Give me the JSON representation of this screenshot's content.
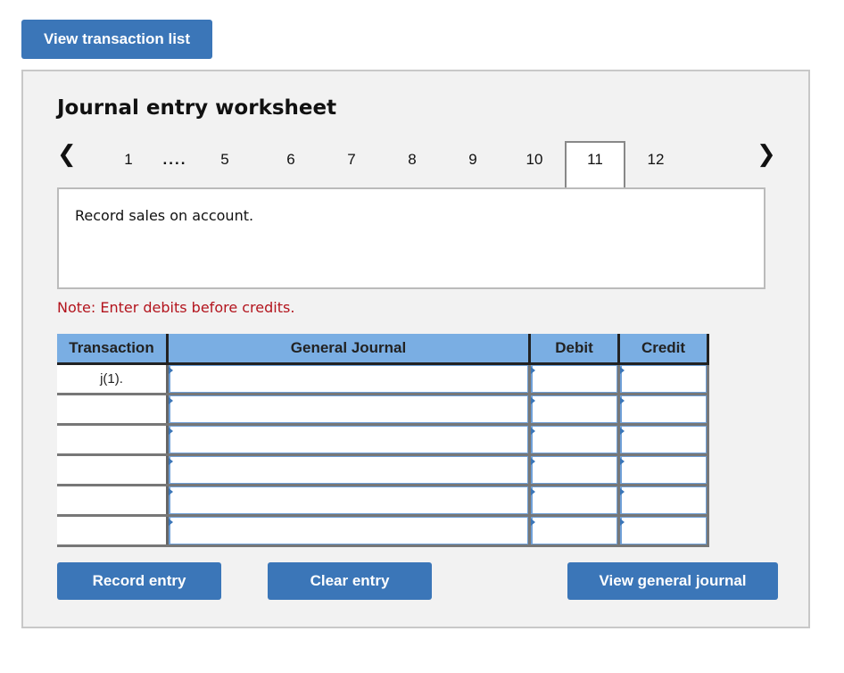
{
  "header": {
    "view_list_label": "View transaction list"
  },
  "worksheet": {
    "title": "Journal entry worksheet",
    "prev_icon": "chevron-left-icon",
    "next_icon": "chevron-right-icon",
    "tabs": [
      {
        "label": "1"
      },
      {
        "label": "...."
      },
      {
        "label": "5"
      },
      {
        "label": "6"
      },
      {
        "label": "7"
      },
      {
        "label": "8"
      },
      {
        "label": "9"
      },
      {
        "label": "10"
      },
      {
        "label": "11",
        "active": true
      },
      {
        "label": "12"
      }
    ],
    "description": "Record sales on account.",
    "note": "Note: Enter debits before credits."
  },
  "table": {
    "headers": [
      "Transaction",
      "General Journal",
      "Debit",
      "Credit"
    ],
    "rows": [
      {
        "transaction": "j(1).",
        "account": "",
        "debit": "",
        "credit": ""
      },
      {
        "transaction": "",
        "account": "",
        "debit": "",
        "credit": ""
      },
      {
        "transaction": "",
        "account": "",
        "debit": "",
        "credit": ""
      },
      {
        "transaction": "",
        "account": "",
        "debit": "",
        "credit": ""
      },
      {
        "transaction": "",
        "account": "",
        "debit": "",
        "credit": ""
      },
      {
        "transaction": "",
        "account": "",
        "debit": "",
        "credit": ""
      }
    ]
  },
  "actions": {
    "record_label": "Record entry",
    "clear_label": "Clear entry",
    "view_gj_label": "View general journal"
  },
  "colors": {
    "accent": "#3b76b8",
    "header_bg": "#7aaee3",
    "note": "#b3141d"
  }
}
